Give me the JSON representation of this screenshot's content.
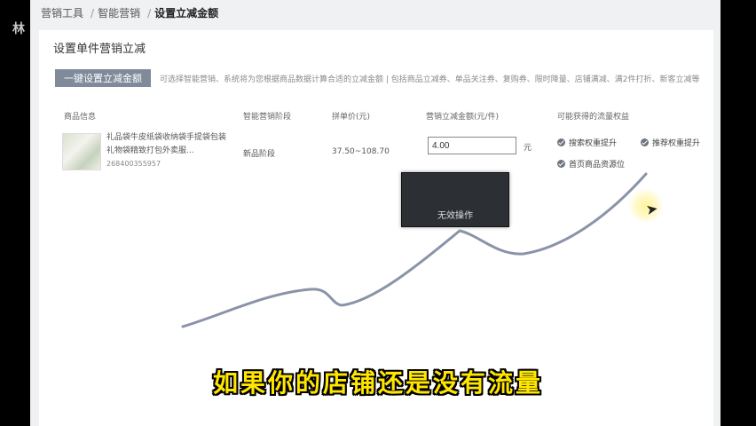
{
  "side_label": "林",
  "breadcrumb": {
    "items": [
      "营销工具",
      "智能营销"
    ],
    "current": "设置立减金额",
    "separator": "/"
  },
  "panel": {
    "title": "设置单件营销立减",
    "batch_button": "一键设置立减金额",
    "batch_hint": "可选择智能营销、系统将为您根据商品数据计算合适的立减金额 | 包括商品立减券、单品关注券、复购券、限时降量、店铺满减、满2件打折、新客立减等"
  },
  "table": {
    "headers": [
      "商品信息",
      "智能营销阶段",
      "拼单价(元)",
      "营销立减金额(元/件)",
      "可能获得的流量权益"
    ],
    "row": {
      "product_name": "礼品袋牛皮纸袋收纳袋手提袋包装礼物袋精致打包外卖服...",
      "product_id": "268400355957",
      "stage": "新品阶段",
      "price": "37.50~108.70",
      "discount_value": "4.00",
      "unit": "元",
      "benefits": [
        "搜索权重提升",
        "推荐权重提升",
        "首页商品资源位"
      ]
    }
  },
  "toast": {
    "text": "无效操作"
  },
  "caption": "如果你的店铺还是没有流量",
  "colors": {
    "caption": "#ffe600",
    "curve": "#8a93a8",
    "button": "#7f8a9b"
  }
}
